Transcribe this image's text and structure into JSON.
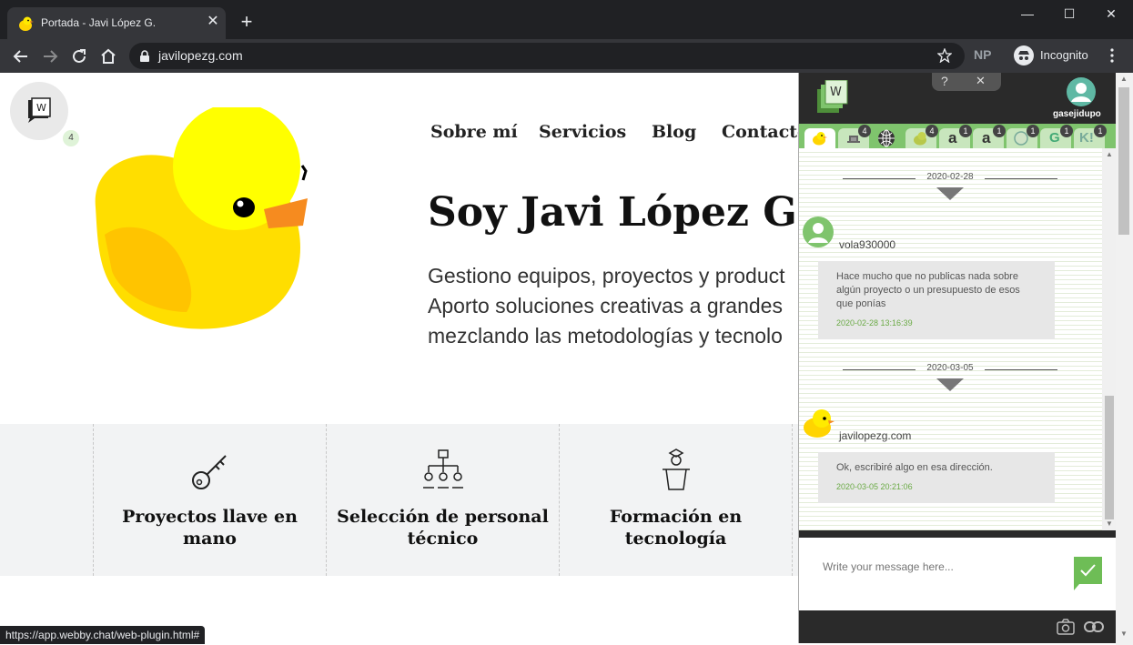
{
  "browser": {
    "tab_title": "Portada - Javi López G.",
    "tab_close": "✕",
    "new_tab": "+",
    "url": "javilopezg.com",
    "incognito_label": "Incognito",
    "extension_label": "NP",
    "window_controls": [
      "—",
      "☐",
      "✕"
    ]
  },
  "site": {
    "nav": [
      "Sobre mí",
      "Servicios",
      "Blog",
      "Contacto"
    ],
    "hero_title": "Soy Javi López G.",
    "hero_lines": [
      "Gestiono equipos, proyectos y product",
      "Aporto soluciones creativas a grandes",
      "mezclando las metodologías y tecnolo"
    ],
    "features": [
      {
        "title": "Proyectos llave en mano",
        "icon": "key-icon"
      },
      {
        "title": "Selección de personal técnico",
        "icon": "org-chart-icon"
      },
      {
        "title": "Formación en tecnología",
        "icon": "teacher-icon"
      }
    ],
    "status_url": "https://app.webby.chat/web-plugin.html#",
    "webby_launcher_count": "4"
  },
  "webby": {
    "help": "?",
    "close": "✕",
    "user_name": "gasejidupo",
    "site_tabs": [
      {
        "icon": "duck-icon",
        "badge": "",
        "active": true
      },
      {
        "icon": "hat-icon",
        "badge": "4",
        "active": false
      },
      {
        "icon": "globe-icon",
        "badge": "",
        "active": false
      },
      {
        "icon": "duck-icon",
        "badge": "4",
        "active": false
      },
      {
        "icon": "amazon-icon",
        "badge": "1",
        "active": false
      },
      {
        "icon": "amazon-icon",
        "badge": "1",
        "active": false
      },
      {
        "icon": "globe-icon",
        "badge": "1",
        "active": false
      },
      {
        "icon": "google-icon",
        "badge": "1",
        "active": false
      },
      {
        "icon": "k-icon",
        "badge": "1",
        "active": false
      }
    ],
    "tab_glyphs": [
      "",
      "",
      "",
      "",
      "a",
      "a",
      "",
      "G",
      "K!"
    ],
    "messages": [
      {
        "date": "2020-02-28",
        "user": "vola930000",
        "text": "Hace mucho que no publicas nada sobre algún proyecto o un presupuesto de esos que ponías",
        "time": "2020-02-28 13:16:39"
      },
      {
        "date": "2020-03-05",
        "user": "javilopezg.com",
        "text": "Ok, escribiré algo en esa dirección.",
        "time": "2020-03-05 20:21:06"
      }
    ],
    "composer_placeholder": "Write your message here..."
  }
}
